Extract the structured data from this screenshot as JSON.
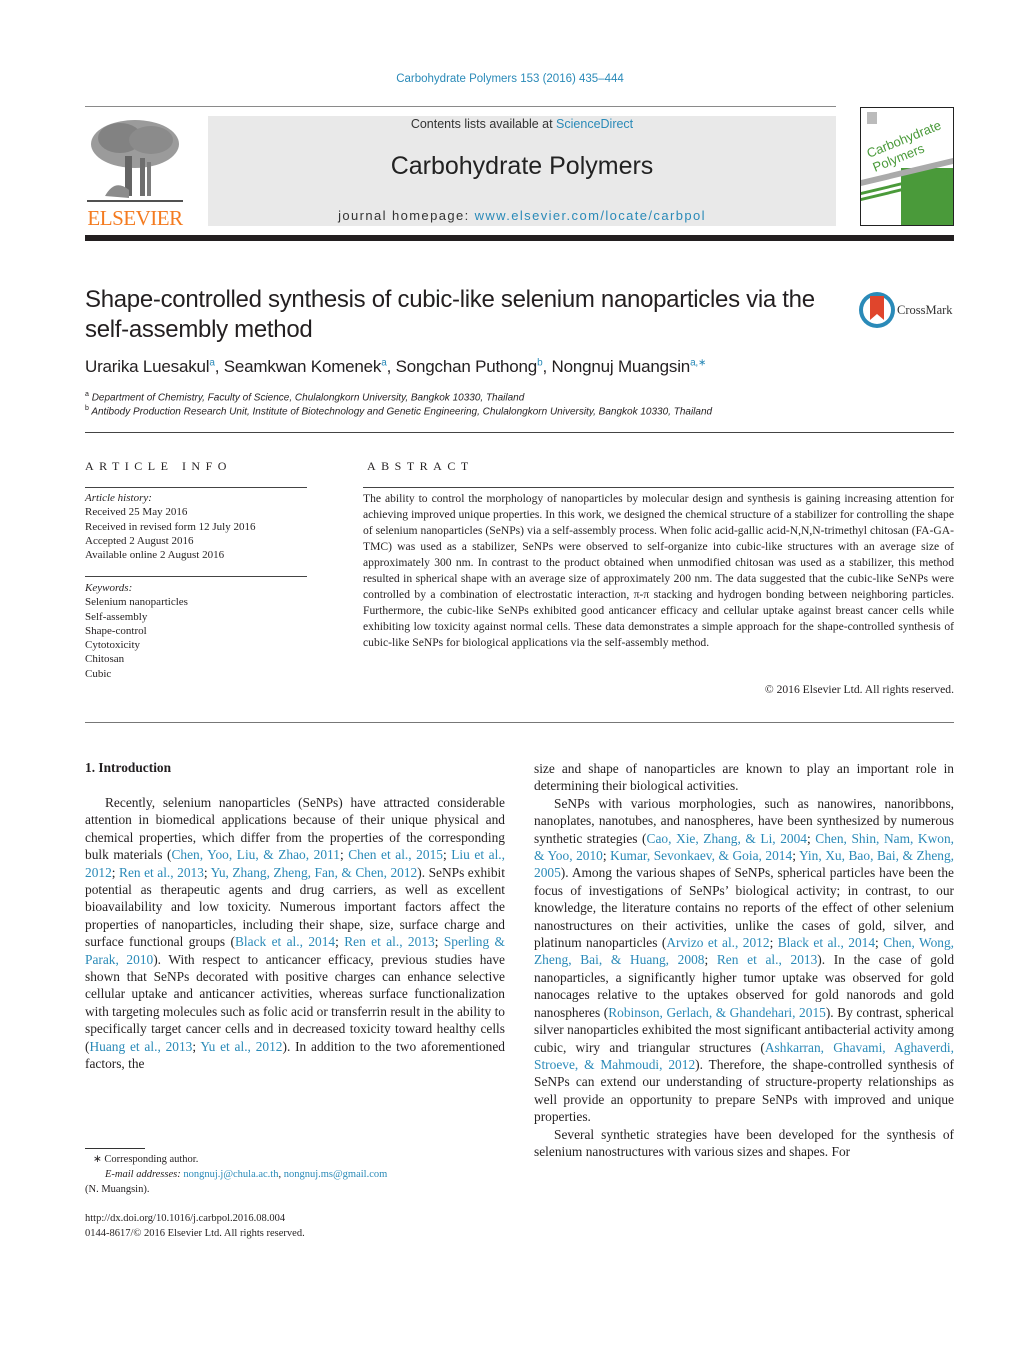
{
  "header": {
    "journal_ref": "Carbohydrate Polymers 153 (2016) 435–444",
    "contents_prefix": "Contents lists available at ",
    "contents_link": "ScienceDirect",
    "journal_title": "Carbohydrate Polymers",
    "homepage_prefix": "journal homepage: ",
    "homepage_link": "www.elsevier.com/locate/carbpol",
    "publisher": "ELSEVIER",
    "cover_title_line1": "Carbohydrate",
    "cover_title_line2": "Polymers",
    "accent_colors": {
      "link": "#2a8ab8",
      "elsevier_orange": "#f47b20",
      "cover_green": "#4a9a3a"
    }
  },
  "article": {
    "title": "Shape-controlled synthesis of cubic-like selenium nanoparticles via the self-assembly method",
    "crossmark_label": "CrossMark",
    "authors": [
      {
        "name": "Urarika Luesakul",
        "sup": "a"
      },
      {
        "name": "Seamkwan Komenek",
        "sup": "a"
      },
      {
        "name": "Songchan Puthong",
        "sup": "b"
      },
      {
        "name": "Nongnuj Muangsin",
        "sup": "a,∗"
      }
    ],
    "affiliations": [
      {
        "sup": "a",
        "text": "Department of Chemistry, Faculty of Science, Chulalongkorn University, Bangkok 10330, Thailand"
      },
      {
        "sup": "b",
        "text": "Antibody Production Research Unit, Institute of Biotechnology and Genetic Engineering, Chulalongkorn University, Bangkok 10330, Thailand"
      }
    ]
  },
  "article_info": {
    "label": "ARTICLE INFO",
    "history_label": "Article history:",
    "history": [
      "Received 25 May 2016",
      "Received in revised form 12 July 2016",
      "Accepted 2 August 2016",
      "Available online 2 August 2016"
    ],
    "keywords_label": "Keywords:",
    "keywords": [
      "Selenium nanoparticles",
      "Self-assembly",
      "Shape-control",
      "Cytotoxicity",
      "Chitosan",
      "Cubic"
    ]
  },
  "abstract": {
    "label": "ABSTRACT",
    "text": "The ability to control the morphology of nanoparticles by molecular design and synthesis is gaining increasing attention for achieving improved unique properties. In this work, we designed the chemical structure of a stabilizer for controlling the shape of selenium nanoparticles (SeNPs) via a self-assembly process. When folic acid-gallic acid-N,N,N-trimethyl chitosan (FA-GA-TMC) was used as a stabilizer, SeNPs were observed to self-organize into cubic-like structures with an average size of approximately 300 nm. In contrast to the product obtained when unmodified chitosan was used as a stabilizer, this method resulted in spherical shape with an average size of approximately 200 nm. The data suggested that the cubic-like SeNPs were controlled by a combination of electrostatic interaction, π-π stacking and hydrogen bonding between neighboring particles. Furthermore, the cubic-like SeNPs exhibited good anticancer efficacy and cellular uptake against breast cancer cells while exhibiting low toxicity against normal cells. These data demonstrates a simple approach for the shape-controlled synthesis of cubic-like SeNPs for biological applications via the self-assembly method.",
    "copyright": "© 2016 Elsevier Ltd. All rights reserved."
  },
  "body": {
    "section_heading": "1.  Introduction",
    "left_paragraph": [
      {
        "t": "Recently, selenium nanoparticles (SeNPs) have attracted considerable attention in biomedical applications because of their unique physical and chemical properties, which differ from the properties of the corresponding bulk materials ("
      },
      {
        "l": "Chen, Yoo, Liu, & Zhao, 2011"
      },
      {
        "t": "; "
      },
      {
        "l": "Chen et al., 2015"
      },
      {
        "t": "; "
      },
      {
        "l": "Liu et al., 2012"
      },
      {
        "t": "; "
      },
      {
        "l": "Ren et al., 2013"
      },
      {
        "t": "; "
      },
      {
        "l": "Yu, Zhang, Zheng, Fan, & Chen, 2012"
      },
      {
        "t": "). SeNPs exhibit potential as therapeutic agents and drug carriers, as well as excellent bioavailability and low toxicity. Numerous important factors affect the properties of nanoparticles, including their shape, size, surface charge and surface functional groups ("
      },
      {
        "l": "Black et al., 2014"
      },
      {
        "t": "; "
      },
      {
        "l": "Ren et al., 2013"
      },
      {
        "t": "; "
      },
      {
        "l": "Sperling & Parak, 2010"
      },
      {
        "t": "). With respect to anticancer efficacy, previous studies have shown that SeNPs decorated with positive charges can enhance selective cellular uptake and anticancer activities, whereas surface functionalization with targeting molecules such as folic acid or transferrin result in the ability to specifically target cancer cells and in decreased toxicity toward healthy cells ("
      },
      {
        "l": "Huang et al., 2013"
      },
      {
        "t": "; "
      },
      {
        "l": "Yu et al., 2012"
      },
      {
        "t": "). In addition to the two aforementioned factors, the"
      }
    ],
    "right_paragraphs": [
      [
        {
          "t": "size and shape of nanoparticles are known to play an important role in determining their biological activities."
        }
      ],
      [
        {
          "t": "SeNPs with various morphologies, such as nanowires, nanoribbons, nanoplates, nanotubes, and nanospheres, have been synthesized by numerous synthetic strategies ("
        },
        {
          "l": "Cao, Xie, Zhang, & Li, 2004"
        },
        {
          "t": "; "
        },
        {
          "l": "Chen, Shin, Nam, Kwon, & Yoo, 2010"
        },
        {
          "t": "; "
        },
        {
          "l": "Kumar, Sevonkaev, & Goia, 2014"
        },
        {
          "t": "; "
        },
        {
          "l": "Yin, Xu, Bao, Bai, & Zheng, 2005"
        },
        {
          "t": "). Among the various shapes of SeNPs, spherical particles have been the focus of investigations of SeNPs’ biological activity; in contrast, to our knowledge, the literature contains no reports of the effect of other selenium nanostructures on their activities, unlike the cases of gold, silver, and platinum nanoparticles ("
        },
        {
          "l": "Arvizo et al., 2012"
        },
        {
          "t": "; "
        },
        {
          "l": "Black et al., 2014"
        },
        {
          "t": "; "
        },
        {
          "l": "Chen, Wong, Zheng, Bai, & Huang, 2008"
        },
        {
          "t": "; "
        },
        {
          "l": "Ren et al., 2013"
        },
        {
          "t": "). In the case of gold nanoparticles, a significantly higher tumor uptake was observed for gold nanocages relative to the uptakes observed for gold nanorods and gold nanospheres ("
        },
        {
          "l": "Robinson, Gerlach, & Ghandehari, 2015"
        },
        {
          "t": "). By contrast, spherical silver nanoparticles exhibited the most significant antibacterial activity among cubic, wiry and triangular structures ("
        },
        {
          "l": "Ashkarran, Ghavami, Aghaverdi, Stroeve, & Mahmoudi, 2012"
        },
        {
          "t": "). Therefore, the shape-controlled synthesis of SeNPs can extend our understanding of structure-property relationships as well provide an opportunity to prepare SeNPs with improved and unique properties."
        }
      ],
      [
        {
          "t": "Several synthetic strategies have been developed for the synthesis of selenium nanostructures with various sizes and shapes. For"
        }
      ]
    ]
  },
  "footnotes": {
    "corresponding": "∗  Corresponding author.",
    "email_label": "E-mail addresses: ",
    "emails": [
      "nongnuj.j@chula.ac.th",
      "nongnuj.ms@gmail.com"
    ],
    "email_owner": "(N. Muangsin).",
    "doi": "http://dx.doi.org/10.1016/j.carbpol.2016.08.004",
    "issn_line": "0144-8617/© 2016 Elsevier Ltd. All rights reserved."
  }
}
